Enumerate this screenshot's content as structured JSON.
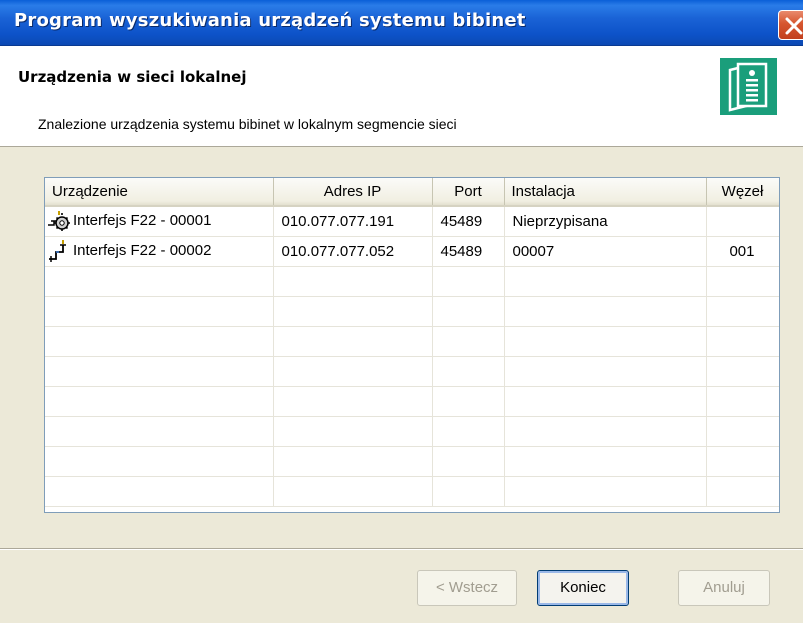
{
  "window": {
    "title": "Program wyszukiwania urządzeń systemu bibinet"
  },
  "header": {
    "title": "Urządzenia w sieci lokalnej",
    "subtitle": "Znalezione urządzenia systemu bibinet w lokalnym segmencie sieci",
    "icon": "document-info-icon"
  },
  "table": {
    "columns": [
      "Urządzenie",
      "Adres IP",
      "Port",
      "Instalacja",
      "Węzeł"
    ],
    "rows": [
      {
        "icon": "device-gear-icon",
        "device": "Interfejs F22 - 00001",
        "ip": "010.077.077.191",
        "port": "45489",
        "installation": "Nieprzypisana",
        "node": ""
      },
      {
        "icon": "device-plug-icon",
        "device": "Interfejs F22 - 00002",
        "ip": "010.077.077.052",
        "port": "45489",
        "installation": "00007",
        "node": "001"
      }
    ]
  },
  "buttons": {
    "back": "< Wstecz",
    "finish": "Koniec",
    "cancel": "Anuluj"
  },
  "colors": {
    "titlebar": "#0d53c9",
    "header_icon_bg": "#1a9e7b",
    "close_button": "#d6562f"
  }
}
